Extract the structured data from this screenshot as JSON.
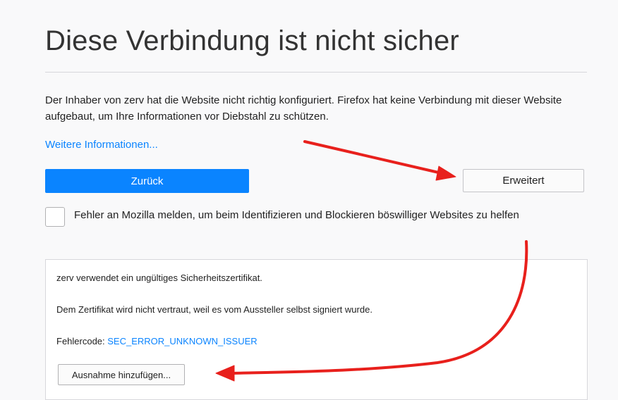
{
  "error_page": {
    "title": "Diese Verbindung ist nicht sicher",
    "description": "Der Inhaber von zerv hat die Website nicht richtig konfiguriert. Firefox hat keine Verbindung mit dieser Website aufgebaut, um Ihre Informationen vor Diebstahl zu schützen.",
    "more_info_link": "Weitere Informationen...",
    "back_button": "Zurück",
    "advanced_button": "Erweitert",
    "report_checkbox_label": "Fehler an Mozilla melden, um beim Identifizieren und Blockieren böswilliger Websites zu helfen"
  },
  "advanced_panel": {
    "invalid_cert_text": "zerv verwendet ein ungültiges Sicherheitszertifikat.",
    "untrusted_text": "Dem Zertifikat wird nicht vertraut, weil es vom Aussteller selbst signiert wurde.",
    "error_code_label": "Fehlercode: ",
    "error_code": "SEC_ERROR_UNKNOWN_ISSUER",
    "add_exception_button": "Ausnahme hinzufügen..."
  },
  "annotations": {
    "arrow_color": "#e8201c"
  },
  "colors": {
    "accent": "#0a84ff",
    "background": "#f9f9fa"
  }
}
